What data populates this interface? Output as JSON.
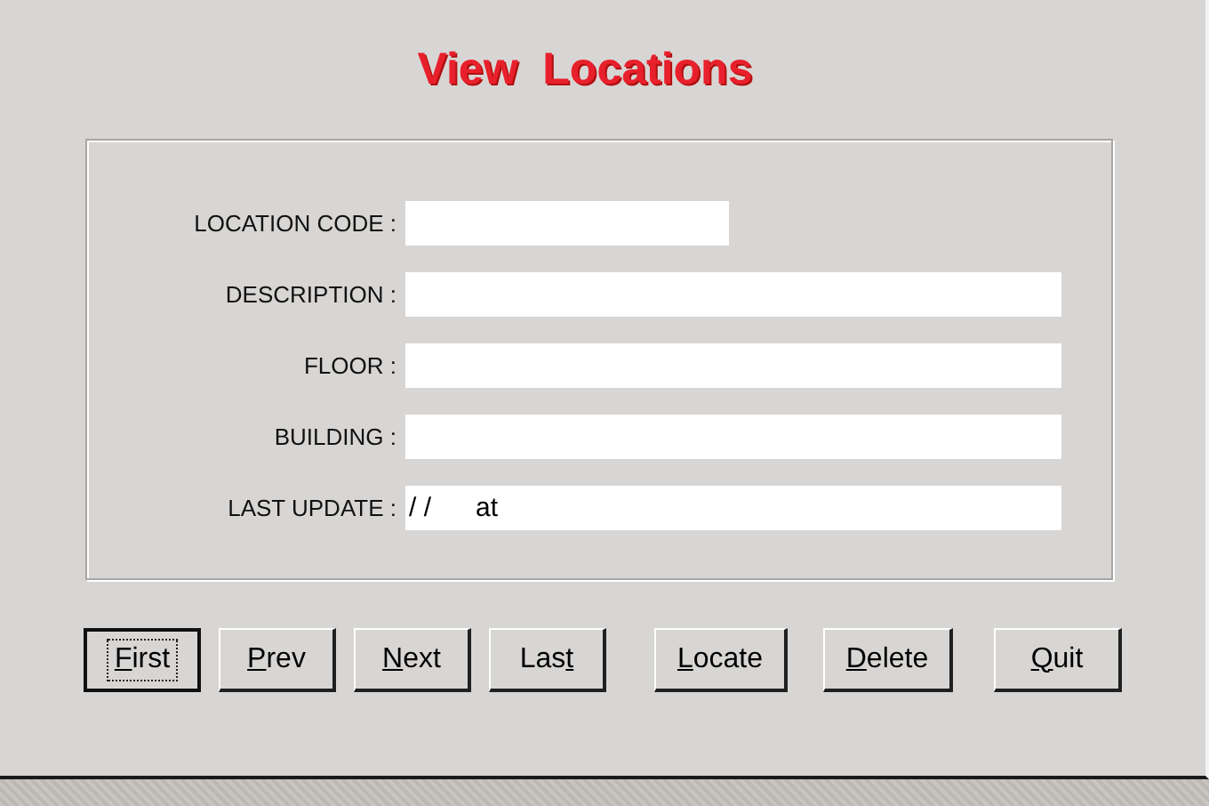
{
  "title": "View  Locations",
  "fields": [
    {
      "label": "LOCATION CODE :",
      "kind": "short"
    },
    {
      "label": "DESCRIPTION :",
      "kind": "long"
    },
    {
      "label": "FLOOR :",
      "kind": "long"
    },
    {
      "label": "BUILDING :",
      "kind": "long"
    },
    {
      "label": "LAST UPDATE :",
      "kind": "long",
      "value": "/ /      at"
    }
  ],
  "buttons": [
    {
      "key": "F",
      "after": "irst",
      "focused": true
    },
    {
      "key": "P",
      "after": "rev",
      "focused": false
    },
    {
      "key": "N",
      "after": "ext",
      "focused": false
    },
    {
      "before": "Las",
      "key": "t",
      "focused": false
    },
    {
      "key": "L",
      "after": "ocate",
      "focused": false
    },
    {
      "key": "D",
      "after": "elete",
      "focused": false
    },
    {
      "key": "Q",
      "after": "uit",
      "focused": false
    }
  ]
}
